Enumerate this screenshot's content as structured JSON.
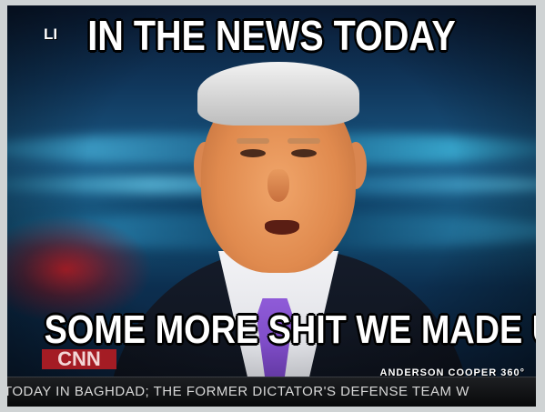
{
  "meme": {
    "top_text": "IN THE NEWS TODAY",
    "bottom_text": "SOME MORE SHIT WE MADE UP"
  },
  "broadcast": {
    "corner_logo": "LI",
    "network_bug": "CNN",
    "show_logo": "ANDERSON COOPER 360°",
    "ticker_text": "TODAY IN BAGHDAD; THE FORMER DICTATOR'S DEFENSE TEAM W"
  },
  "colors": {
    "studio_blue": "#1b5a86",
    "tie_purple": "#8f5bd8",
    "network_red": "#a41c24"
  }
}
